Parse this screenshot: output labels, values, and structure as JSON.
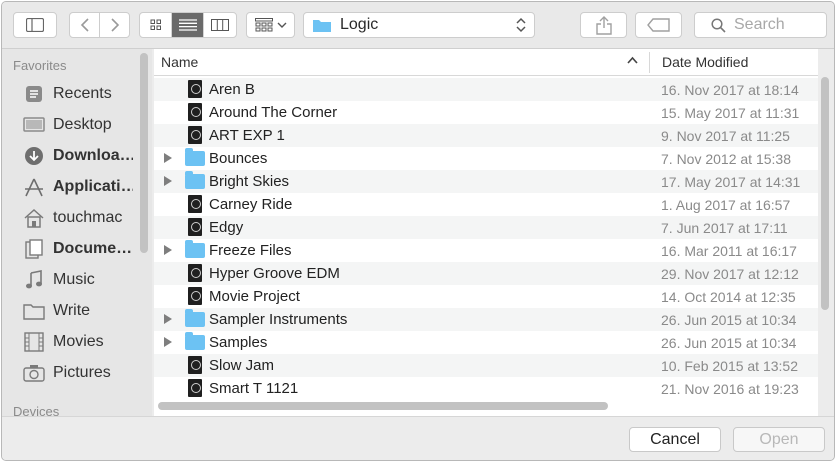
{
  "toolbar": {
    "path_folder": "Logic",
    "search_placeholder": "Search"
  },
  "sidebar": {
    "favorites_heading": "Favorites",
    "devices_heading": "Devices",
    "items": [
      {
        "label": "Recents",
        "icon": "recents-icon"
      },
      {
        "label": "Desktop",
        "icon": "desktop-icon"
      },
      {
        "label": "Downloa…",
        "icon": "downloads-icon"
      },
      {
        "label": "Applicati…",
        "icon": "applications-icon"
      },
      {
        "label": "touchmac",
        "icon": "home-icon"
      },
      {
        "label": "Docume…",
        "icon": "documents-icon"
      },
      {
        "label": "Music",
        "icon": "music-icon"
      },
      {
        "label": "Write",
        "icon": "folder-icon"
      },
      {
        "label": "Movies",
        "icon": "movies-icon"
      },
      {
        "label": "Pictures",
        "icon": "pictures-icon"
      }
    ]
  },
  "list": {
    "col_name": "Name",
    "col_date": "Date Modified",
    "rows": [
      {
        "name": "Aren B",
        "date": "16. Nov 2017 at 18:14",
        "kind": "file"
      },
      {
        "name": "Around The Corner",
        "date": "15. May 2017 at 11:31",
        "kind": "file"
      },
      {
        "name": "ART EXP 1",
        "date": "9. Nov 2017 at 11:25",
        "kind": "file"
      },
      {
        "name": "Bounces",
        "date": "7. Nov 2012 at 15:38",
        "kind": "folder"
      },
      {
        "name": "Bright Skies",
        "date": "17. May 2017 at 14:31",
        "kind": "folder"
      },
      {
        "name": "Carney Ride",
        "date": "1. Aug 2017 at 16:57",
        "kind": "file"
      },
      {
        "name": "Edgy",
        "date": "7. Jun 2017 at 17:11",
        "kind": "file"
      },
      {
        "name": "Freeze Files",
        "date": "16. Mar 2011 at 16:17",
        "kind": "folder"
      },
      {
        "name": "Hyper Groove EDM",
        "date": "29. Nov 2017 at 12:12",
        "kind": "file"
      },
      {
        "name": "Movie Project",
        "date": "14. Oct 2014 at 12:35",
        "kind": "file"
      },
      {
        "name": "Sampler Instruments",
        "date": "26. Jun 2015 at 10:34",
        "kind": "folder"
      },
      {
        "name": "Samples",
        "date": "26. Jun 2015 at 10:34",
        "kind": "folder"
      },
      {
        "name": "Slow Jam",
        "date": "10. Feb 2015 at 13:52",
        "kind": "file"
      },
      {
        "name": "Smart T 1121",
        "date": "21. Nov 2016 at 19:23",
        "kind": "file"
      }
    ]
  },
  "buttons": {
    "cancel": "Cancel",
    "open": "Open"
  },
  "colors": {
    "folder": "#6cc2f3",
    "active_segment": "#6a6a6a"
  }
}
